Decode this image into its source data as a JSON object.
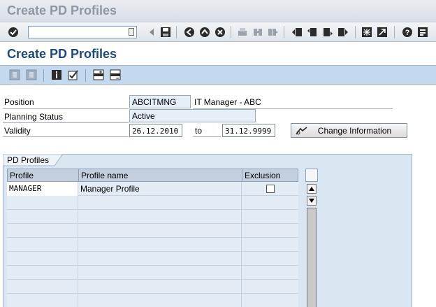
{
  "window": {
    "title": "Create PD Profiles"
  },
  "screen": {
    "title": "Create PD Profiles"
  },
  "system_toolbar": {
    "icons": [
      "enter-icon",
      "command-field",
      "back-arrow-icon",
      "save-icon",
      "back-icon",
      "exit-icon",
      "cancel-icon",
      "print-icon",
      "find-icon",
      "find-next-icon",
      "first-page-icon",
      "previous-page-icon",
      "next-page-icon",
      "last-page-icon",
      "new-session-icon",
      "shortcut-icon",
      "help-icon",
      "layout-menu-icon"
    ]
  },
  "app_toolbar": {
    "icons": [
      "copy-icon-disabled",
      "delete-icon-disabled",
      "information-icon",
      "check-icon",
      "insert-row-icon",
      "delete-row-icon"
    ]
  },
  "header": {
    "position_label": "Position",
    "position_code": "ABCITMNG",
    "position_text": "IT Manager - ABC",
    "planning_status_label": "Planning Status",
    "planning_status_value": "Active",
    "validity_label": "Validity",
    "validity_from": "26.12.2010",
    "validity_to_label": "to",
    "validity_to": "31.12.9999",
    "change_info_button": "Change Information"
  },
  "profiles": {
    "group_title": "PD Profiles",
    "columns": [
      "Profile",
      "Profile name",
      "Exclusion"
    ],
    "rows": [
      {
        "profile": "MANAGER",
        "profile_name": "Manager Profile",
        "exclusion": false
      },
      {
        "profile": "",
        "profile_name": "",
        "exclusion": null
      },
      {
        "profile": "",
        "profile_name": "",
        "exclusion": null
      },
      {
        "profile": "",
        "profile_name": "",
        "exclusion": null
      },
      {
        "profile": "",
        "profile_name": "",
        "exclusion": null
      },
      {
        "profile": "",
        "profile_name": "",
        "exclusion": null
      },
      {
        "profile": "",
        "profile_name": "",
        "exclusion": null
      },
      {
        "profile": "",
        "profile_name": "",
        "exclusion": null
      },
      {
        "profile": "",
        "profile_name": "",
        "exclusion": null
      }
    ]
  }
}
